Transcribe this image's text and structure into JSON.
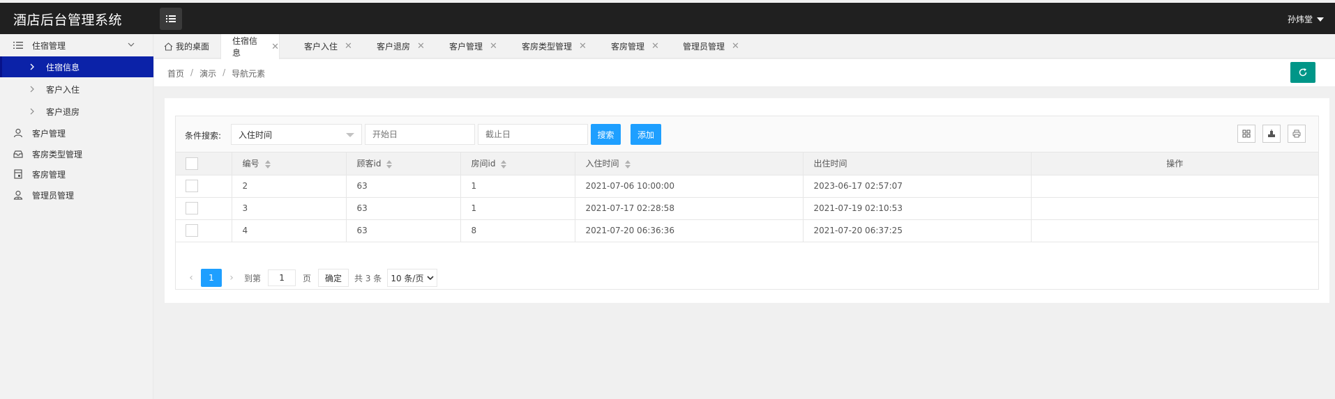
{
  "app": {
    "title": "酒店后台管理系统",
    "user": "孙炜堂"
  },
  "sidebar": {
    "items": [
      {
        "label": "住宿管理",
        "icon": "list-icon"
      },
      {
        "label": "住宿信息",
        "icon": "chevron-right-icon"
      },
      {
        "label": "客户入住",
        "icon": "chevron-right-icon"
      },
      {
        "label": "客户退房",
        "icon": "chevron-right-icon"
      },
      {
        "label": "客户管理",
        "icon": "user-icon"
      },
      {
        "label": "客房类型管理",
        "icon": "tray-icon"
      },
      {
        "label": "客房管理",
        "icon": "room-icon"
      },
      {
        "label": "管理员管理",
        "icon": "admin-icon"
      }
    ]
  },
  "tabs": [
    {
      "label": "我的桌面"
    },
    {
      "label": "住宿信息"
    },
    {
      "label": "客户入住"
    },
    {
      "label": "客户退房"
    },
    {
      "label": "客户管理"
    },
    {
      "label": "客房类型管理"
    },
    {
      "label": "客房管理"
    },
    {
      "label": "管理员管理"
    }
  ],
  "tab_close": "✕",
  "breadcrumb": {
    "items": [
      "首页",
      "演示",
      "导航元素"
    ],
    "sep": "/"
  },
  "toolbar": {
    "label": "条件搜索:",
    "select_value": "入住时间",
    "start_placeholder": "开始日",
    "end_placeholder": "截止日",
    "search": "搜索",
    "add": "添加"
  },
  "table": {
    "columns": [
      "编号",
      "顾客id",
      "房间id",
      "入住时间",
      "出住时间",
      "操作"
    ],
    "rows": [
      [
        "2",
        "63",
        "1",
        "2021-07-06 10:00:00",
        "2023-06-17 02:57:07",
        ""
      ],
      [
        "3",
        "63",
        "1",
        "2021-07-17 02:28:58",
        "2021-07-19 02:10:53",
        ""
      ],
      [
        "4",
        "63",
        "8",
        "2021-07-20 06:36:36",
        "2021-07-20 06:37:25",
        ""
      ]
    ]
  },
  "pager": {
    "current": "1",
    "goto_label": "到第",
    "goto_value": "1",
    "page_unit": "页",
    "confirm": "确定",
    "total": "共 3 条",
    "page_size": "10 条/页"
  },
  "colors": {
    "topbar": "#202020",
    "active_nav": "#0b22a8",
    "primary": "#1e9fff",
    "refresh": "#009688"
  }
}
